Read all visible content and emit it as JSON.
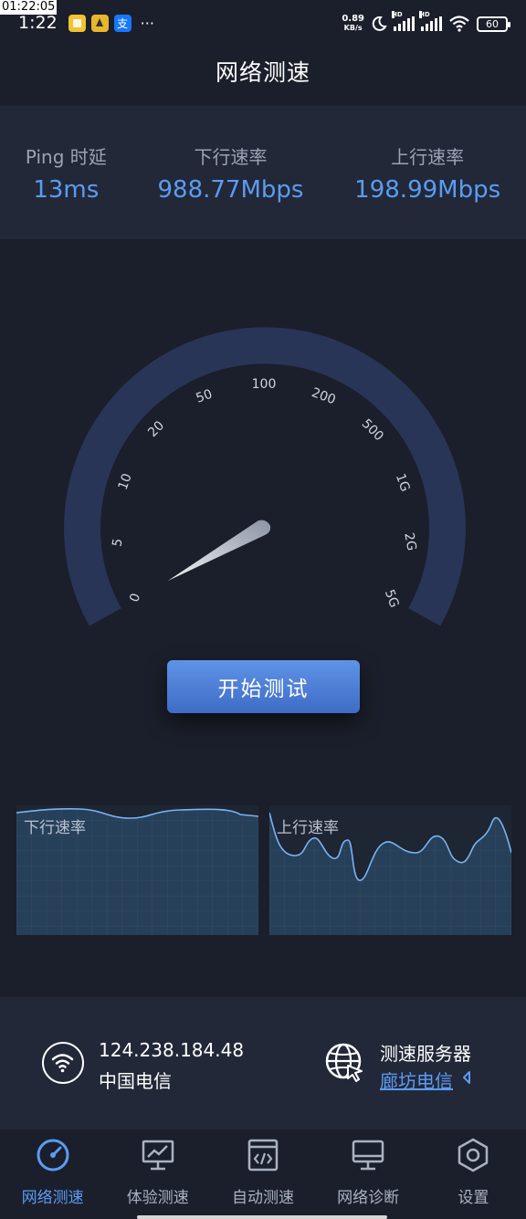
{
  "overlay_clock": "01:22:05",
  "status_bar": {
    "time": "1:22",
    "app_badges": [
      "notes-icon",
      "sail-icon",
      "alipay-icon"
    ],
    "alipay_glyph": "支",
    "more": "···",
    "net_speed_value": "0.89",
    "net_speed_unit": "KB/s",
    "hd1": "HD",
    "hd2": "HD",
    "battery": "60"
  },
  "header": {
    "title": "网络测速"
  },
  "stats": {
    "ping_label": "Ping 时延",
    "ping_value": "13ms",
    "download_label": "下行速率",
    "download_value": "988.77Mbps",
    "upload_label": "上行速率",
    "upload_value": "198.99Mbps"
  },
  "gauge": {
    "ticks": [
      "0",
      "5",
      "10",
      "20",
      "50",
      "100",
      "200",
      "500",
      "1G",
      "2G",
      "5G"
    ],
    "needle_value": "0"
  },
  "start_button": "开始测试",
  "charts": {
    "download_label": "下行速率",
    "upload_label": "上行速率"
  },
  "network_info": {
    "ip": "124.238.184.48",
    "isp": "中国电信",
    "server_title": "测速服务器",
    "server_name": "廊坊电信"
  },
  "tabs": [
    {
      "label": "网络测速",
      "icon": "speedometer-icon",
      "active": true
    },
    {
      "label": "体验测速",
      "icon": "monitor-chart-icon",
      "active": false
    },
    {
      "label": "自动测速",
      "icon": "code-window-icon",
      "active": false
    },
    {
      "label": "网络诊断",
      "icon": "desktop-icon",
      "active": false
    },
    {
      "label": "设置",
      "icon": "settings-hexagon-icon",
      "active": false
    }
  ],
  "colors": {
    "background": "#1b1f2b",
    "panel": "#222838",
    "accent": "#5b9cf2",
    "gauge_arc": "#283557"
  }
}
